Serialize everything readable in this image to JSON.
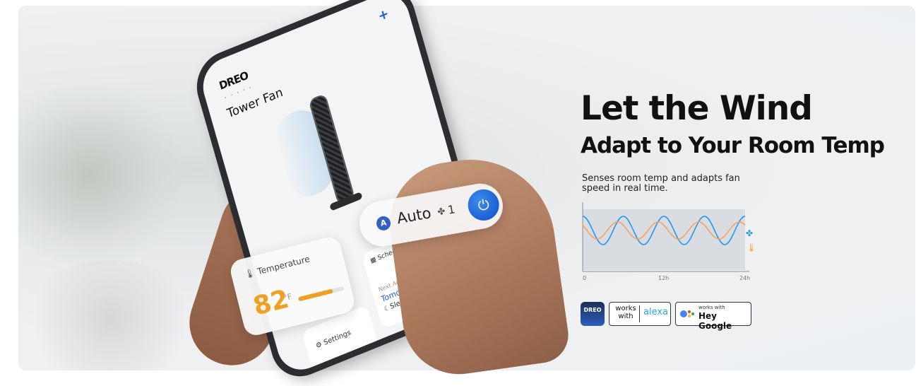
{
  "hero": {
    "headline_line1": "Let the Wind",
    "headline_line2": "Adapt to Your Room Temp",
    "description": "Senses room temp and adapts fan speed in real time."
  },
  "app": {
    "brand": "DREO",
    "page_dots": "• • • • •",
    "add_symbol": "+",
    "device_name": "Tower Fan",
    "mode_badge": "A",
    "mode": "Auto",
    "fan_speed": "1",
    "temperature_label": "Temperature",
    "temperature_value": "82",
    "temperature_unit": "°F",
    "temperature_level": 0.75,
    "schedules_label": "Schedules",
    "next_action_label": "Next Action",
    "next_action_time": "Tomorrow 08:00",
    "next_action_mode": "Sleep",
    "settings_label": "Settings"
  },
  "chart": {
    "x_ticks": [
      "0",
      "12h",
      "24h"
    ]
  },
  "chart_data": {
    "type": "line",
    "x": [
      0,
      3,
      6,
      9,
      12,
      15,
      18,
      21,
      24
    ],
    "series": [
      {
        "values": [
          0.6,
          0.1,
          0.6,
          0.1,
          0.6,
          0.1,
          0.6,
          0.1,
          0.6
        ],
        "color": "#2196f3"
      },
      {
        "values": [
          0.5,
          0.2,
          0.5,
          0.2,
          0.5,
          0.2,
          0.5,
          0.2,
          0.5
        ],
        "color": "#f4a460"
      }
    ],
    "xlabel": "",
    "ylabel": "",
    "x_tick_labels": [
      "0",
      "12h",
      "24h"
    ]
  },
  "badges": {
    "dreo": "DREO",
    "alexa_works": "works with",
    "alexa_word": "alexa",
    "google_small": "works with",
    "google_big": "Hey Google"
  },
  "colors": {
    "accent_blue": "#1559cf",
    "accent_orange": "#f0a020"
  }
}
